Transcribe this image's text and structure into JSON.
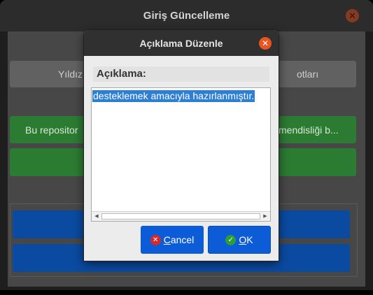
{
  "outer_window": {
    "title": "Giriş Güncelleme",
    "close_glyph": "✕",
    "buttons": {
      "grey_left_fragment": "Yıldız",
      "grey_right_fragment": "otları",
      "green_left_fragment": "Bu repositor",
      "green_right_fragment": "mendisliği b..."
    }
  },
  "dialog": {
    "title": "Açıklama Düzenle",
    "close_glyph": "✕",
    "field_label": "Açıklama:",
    "text_value": "desteklemek amacıyla hazırlanmıştır.",
    "scroll_left": "◀",
    "scroll_right": "▶",
    "cancel_label": "Cancel",
    "ok_label": "OK",
    "cancel_icon": "✕",
    "ok_icon": "✓"
  },
  "colors": {
    "accent": "#e95420",
    "button_blue": "#0b5cd6",
    "selection": "#2d7fd3",
    "green": "#2c7b33"
  }
}
